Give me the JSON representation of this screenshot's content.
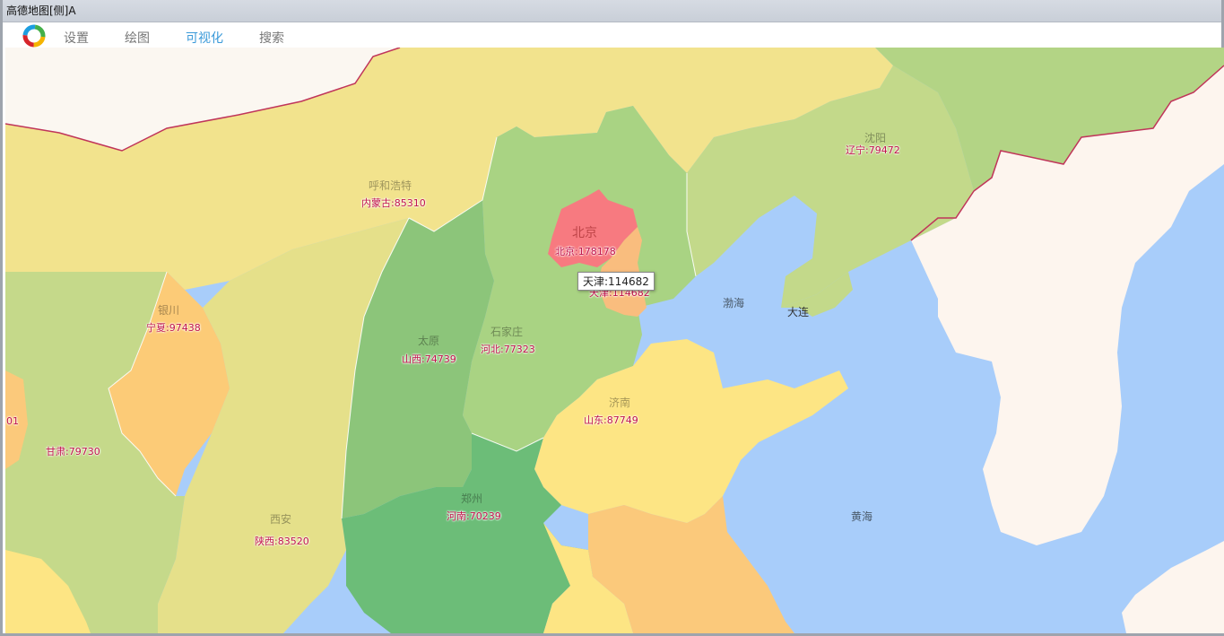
{
  "window": {
    "title": "高德地图[侧]A"
  },
  "menu": {
    "items": [
      {
        "label": "设置",
        "active": false
      },
      {
        "label": "绘图",
        "active": false
      },
      {
        "label": "可视化",
        "active": true
      },
      {
        "label": "搜索",
        "active": false
      }
    ],
    "active_color": "#3b9ad9"
  },
  "map": {
    "regions": [
      {
        "name": "内蒙古",
        "value": 85310,
        "label": "内蒙古:85310",
        "color": "#f2e38d"
      },
      {
        "name": "辽宁",
        "value": 79472,
        "label": "辽宁:79472",
        "color": "#c3d98a"
      },
      {
        "name": "北京",
        "value": 178178,
        "label": "北京:178178",
        "color": "#f77a80"
      },
      {
        "name": "天津",
        "value": 114682,
        "label": "天津:114682",
        "color": "#f9bd7e"
      },
      {
        "name": "河北",
        "value": 77323,
        "label": "河北:77323",
        "color": "#a9d383"
      },
      {
        "name": "山西",
        "value": 74739,
        "label": "山西:74739",
        "color": "#8cc57a"
      },
      {
        "name": "宁夏",
        "value": 97438,
        "label": "宁夏:97438",
        "color": "#fccb77"
      },
      {
        "name": "甘肃",
        "value": 79730,
        "label": "甘肃:79730",
        "color": "#c5d98a"
      },
      {
        "name": "陕西",
        "value": 83520,
        "label": "陕西:83520",
        "color": "#e5e08a"
      },
      {
        "name": "山东",
        "value": 87749,
        "label": "山东:87749",
        "color": "#fde584"
      },
      {
        "name": "河南",
        "value": 70239,
        "label": "河南:70239",
        "color": "#6cbd78"
      }
    ],
    "cities": [
      "呼和浩特",
      "北京",
      "沈阳",
      "太原",
      "石家庄",
      "银川",
      "济南",
      "郑州",
      "西安",
      "大连"
    ],
    "seas": [
      "渤海",
      "黄海"
    ],
    "partial_label": "01",
    "tooltip": "天津:114682"
  }
}
